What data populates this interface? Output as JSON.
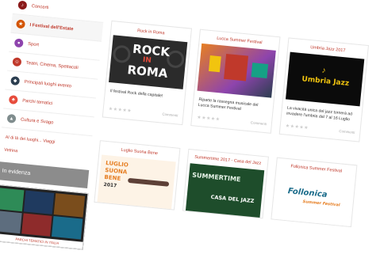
{
  "sidebar": {
    "items": [
      {
        "label": "Concerti",
        "icon": "music-icon",
        "color": "#c0392b"
      },
      {
        "label": "I Festival dell'Estate",
        "icon": "festival-icon",
        "color": "#d35400",
        "active": true
      },
      {
        "label": "Sport",
        "icon": "sport-icon",
        "color": "#8e44ad"
      },
      {
        "label": "Teatri, Cinema, Spettacoli",
        "icon": "theatre-icon",
        "color": "#c0392b"
      },
      {
        "label": "Principali luoghi evento",
        "icon": "location-icon",
        "color": "#2c3e50"
      },
      {
        "label": "Parchi tematici",
        "icon": "park-icon",
        "color": "#e74c3c"
      },
      {
        "label": "Cultura e Svago",
        "icon": "culture-icon",
        "color": "#7f8c8d"
      }
    ],
    "link_all": "Al di là dei luoghi... Viaggi",
    "link_more": "Vetrina"
  },
  "evidenza": {
    "title": "In evidenza",
    "caption": "PARCHI TEMATICI IN ITALIA"
  },
  "cards": [
    {
      "title": "Rock in Roma",
      "image": "rock-in-roma-poster",
      "image_text": [
        "ROCK",
        "IN",
        "ROMA"
      ],
      "desc": "Il festival Rock della capitale!",
      "comments": "Commenti",
      "stars": "★★★★★"
    },
    {
      "title": "Lucca Summer Festival",
      "image": "lucca-summer-festival-poster",
      "image_text": [],
      "desc": "Riparte la rassegna musicale del Lucca Summer Festival",
      "comments": "Commenti",
      "stars": "★★★★★"
    },
    {
      "title": "Umbria Jazz 2017",
      "image": "umbria-jazz-logo",
      "image_text": [
        "Umbria Jazz"
      ],
      "desc": "La vivacità unica del jazz tornerà ad invadere l'umbria dal 7 al 16 Luglio",
      "comments": "Commenti",
      "stars": "★★★★★"
    },
    {
      "title": "Luglio Suona Bene",
      "image": "luglio-suona-bene-poster",
      "image_text": [
        "LUGLIO",
        "SUONA",
        "BENE",
        "2017"
      ],
      "desc": "",
      "comments": "",
      "stars": ""
    },
    {
      "title": "Summertime 2017 - Casa del Jazz",
      "image": "casa-del-jazz-poster",
      "image_text": [
        "SUMMERTIME",
        "CASA DEL JAZZ"
      ],
      "desc": "",
      "comments": "",
      "stars": ""
    },
    {
      "title": "Follonica Summer Festival",
      "image": "follonica-logo",
      "image_text": [
        "Follonica",
        "Summer Festival"
      ],
      "desc": "",
      "comments": "",
      "stars": ""
    }
  ]
}
